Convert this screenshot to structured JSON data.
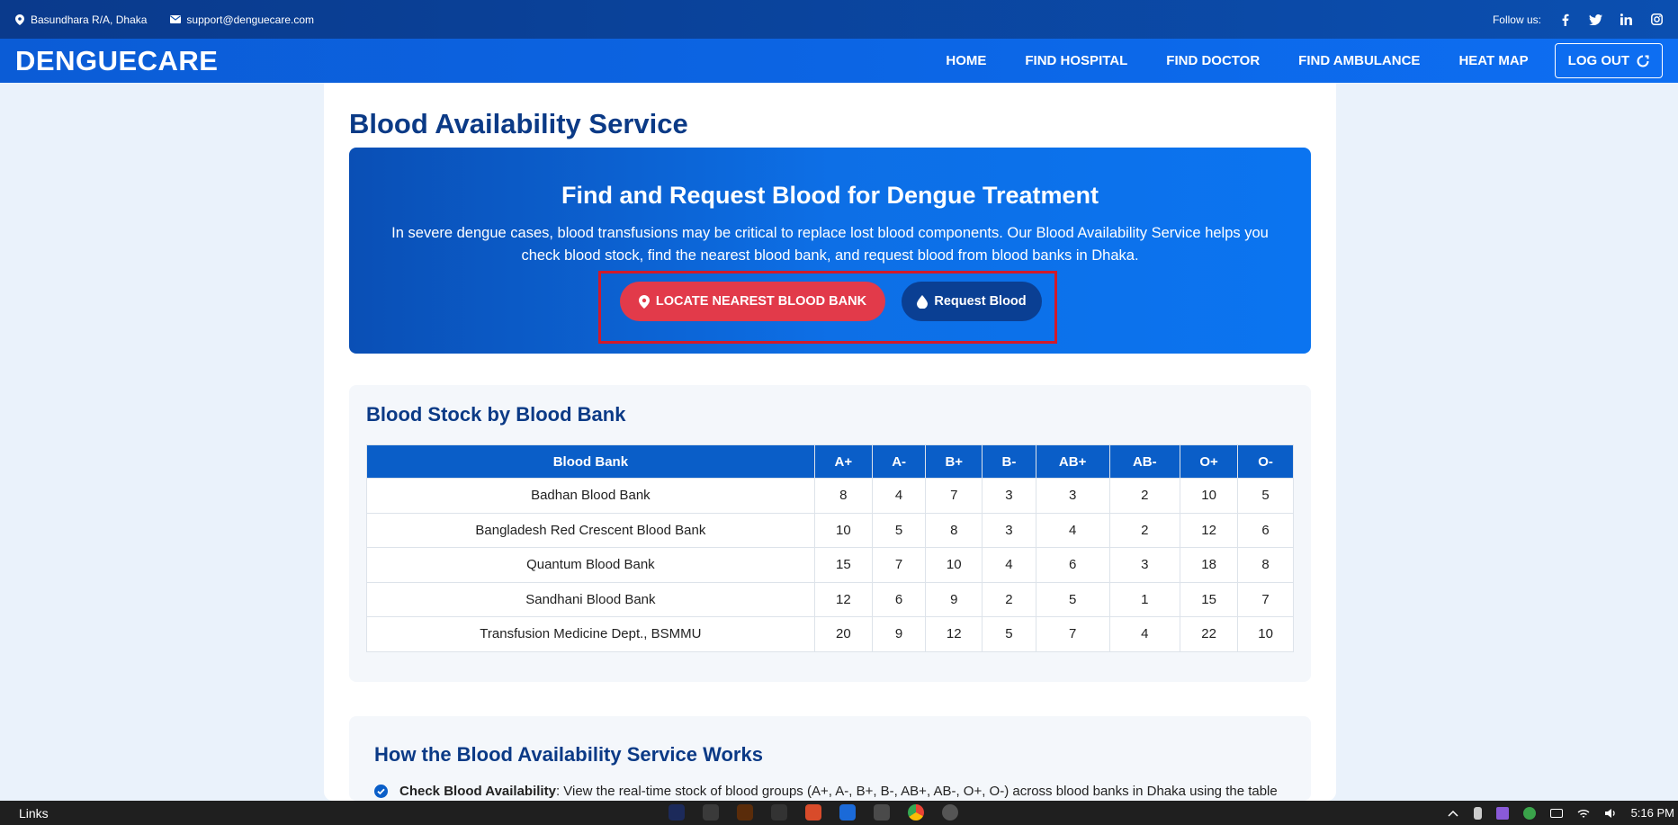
{
  "topbar": {
    "location": "Basundhara R/A, Dhaka",
    "email": "support@denguecare.com",
    "follow_label": "Follow us:",
    "socials": [
      "facebook-icon",
      "twitter-icon",
      "linkedin-icon",
      "instagram-icon"
    ]
  },
  "nav": {
    "brand": "DENGUECARE",
    "links": [
      "HOME",
      "FIND HOSPITAL",
      "FIND DOCTOR",
      "FIND AMBULANCE",
      "HEAT MAP"
    ],
    "logout": "LOG OUT"
  },
  "page": {
    "title": "Blood Availability Service"
  },
  "hero": {
    "heading": "Find and Request Blood for Dengue Treatment",
    "line1": "In severe dengue cases, blood transfusions may be critical to replace lost blood components. Our Blood Availability Service helps you",
    "line2": "check blood stock, find the nearest blood bank, and request blood from blood banks in Dhaka.",
    "locate_button": "LOCATE NEAREST BLOOD BANK",
    "request_button": "Request Blood"
  },
  "stock": {
    "heading": "Blood Stock by Blood Bank",
    "columns": [
      "Blood Bank",
      "A+",
      "A-",
      "B+",
      "B-",
      "AB+",
      "AB-",
      "O+",
      "O-"
    ],
    "rows": [
      [
        "Badhan Blood Bank",
        "8",
        "4",
        "7",
        "3",
        "3",
        "2",
        "10",
        "5"
      ],
      [
        "Bangladesh Red Crescent Blood Bank",
        "10",
        "5",
        "8",
        "3",
        "4",
        "2",
        "12",
        "6"
      ],
      [
        "Quantum Blood Bank",
        "15",
        "7",
        "10",
        "4",
        "6",
        "3",
        "18",
        "8"
      ],
      [
        "Sandhani Blood Bank",
        "12",
        "6",
        "9",
        "2",
        "5",
        "1",
        "15",
        "7"
      ],
      [
        "Transfusion Medicine Dept., BSMMU",
        "20",
        "9",
        "12",
        "5",
        "7",
        "4",
        "22",
        "10"
      ]
    ]
  },
  "how": {
    "heading": "How the Blood Availability Service Works",
    "step1_bold": "Check Blood Availability",
    "step1_text": ": View the real-time stock of blood groups (A+, A-, B+, B-, AB+, AB-, O+, O-) across blood banks in Dhaka using the table"
  },
  "taskbar": {
    "links": "Links",
    "time": "5:16 PM"
  },
  "colors": {
    "primary": "#0a5ec8",
    "title": "#0b3a86",
    "danger": "#e23a4a",
    "dark_button": "#0a3f93"
  }
}
